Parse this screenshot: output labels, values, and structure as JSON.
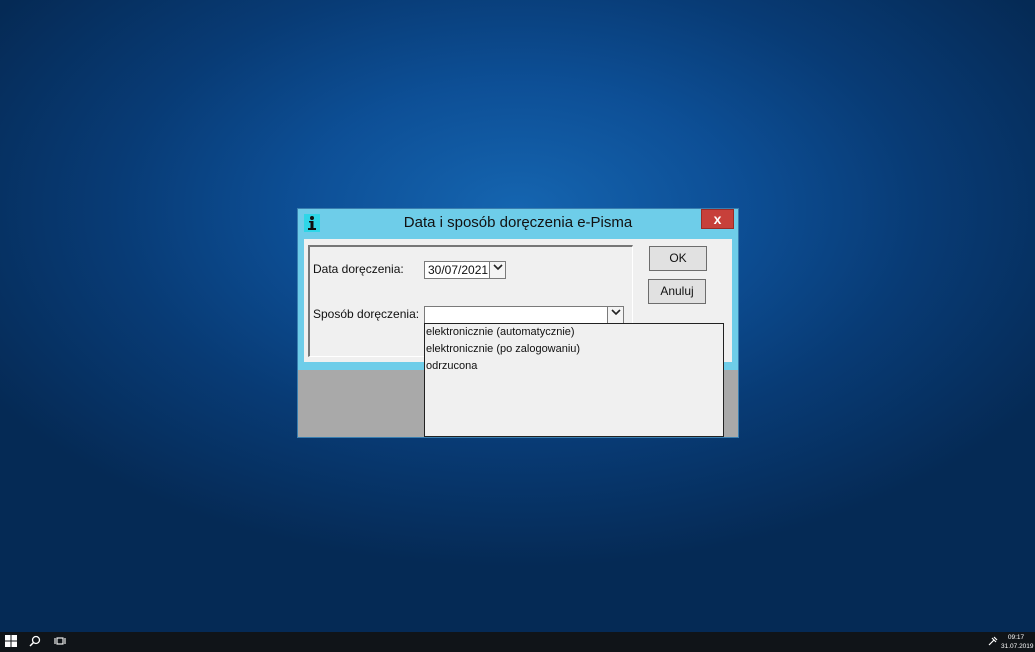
{
  "dialog": {
    "title": "Data i sposób doręczenia e-Pisma",
    "close_label": "x",
    "date_label": "Data doręczenia:",
    "date_value": "30/07/2021",
    "method_label": "Sposób doręczenia:",
    "method_value": "",
    "ok_label": "OK",
    "cancel_label": "Anuluj",
    "method_options": [
      "elektronicznie (automatycznie)",
      "elektronicznie (po zalogowaniu)",
      "odrzucona"
    ]
  },
  "taskbar": {
    "time": "09:17",
    "date": "31.07.2019"
  },
  "icons": {
    "dropdown_arrow": "chevron-down-icon",
    "app": "app-icon"
  }
}
